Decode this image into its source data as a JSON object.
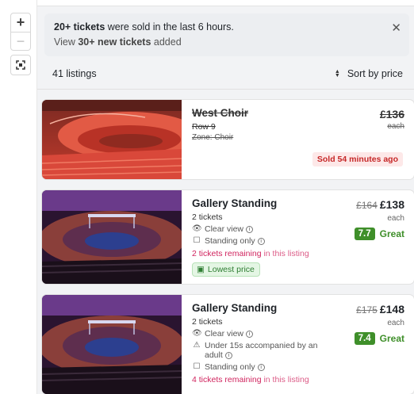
{
  "map_controls": {
    "zoom_in": "+",
    "zoom_out": "−"
  },
  "notice": {
    "line1_bold": "20+ tickets",
    "line1_rest": " were sold in the last 6 hours.",
    "line2_prefix": "View ",
    "line2_bold": "30+ new tickets",
    "line2_rest": " added",
    "close": "✕"
  },
  "listing_bar": {
    "count": "41 listings",
    "sort_label": "Sort by price"
  },
  "listings": [
    {
      "title": "West Choir",
      "row": "Row 9",
      "zone": "Zone: Choir",
      "price": "£136",
      "each": "each",
      "sold_badge": "Sold 54 minutes ago"
    },
    {
      "title": "Gallery Standing",
      "tickets": "2 tickets",
      "features": [
        "Clear view",
        "Standing only"
      ],
      "remaining_bold": "2 tickets remaining",
      "remaining_rest": " in this listing",
      "badge": "Lowest price",
      "old_price": "£164",
      "price": "£138",
      "each": "each",
      "score": "7.7",
      "score_label": "Great"
    },
    {
      "title": "Gallery Standing",
      "tickets": "2 tickets",
      "features": [
        "Clear view",
        "Under 15s accompanied by an adult",
        "Standing only"
      ],
      "remaining_bold": "4 tickets remaining",
      "remaining_rest": " in this listing",
      "old_price": "£175",
      "price": "£148",
      "each": "each",
      "score": "7.4",
      "score_label": "Great"
    }
  ],
  "colors": {
    "accent_green": "#3f8f2a",
    "remaining_pink": "#d0245e",
    "sold_red": "#c62828"
  }
}
